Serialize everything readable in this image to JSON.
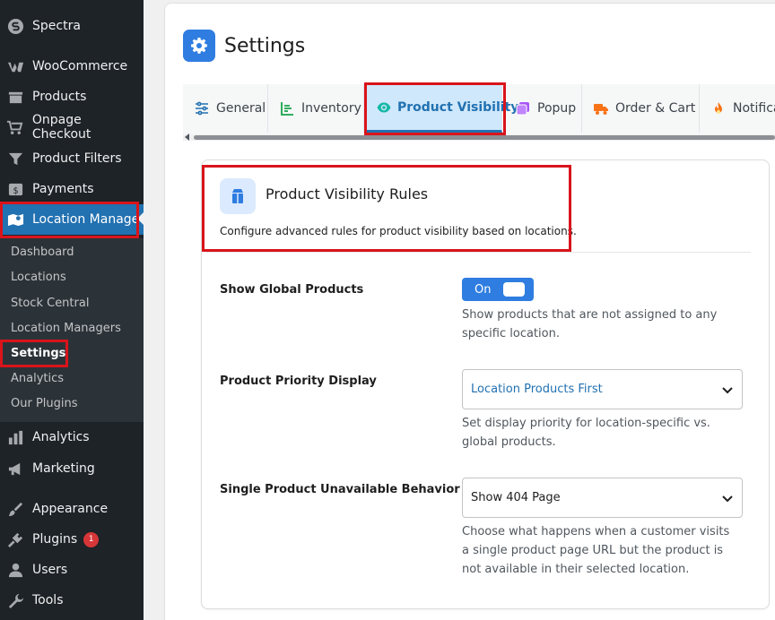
{
  "sidebar": {
    "items": [
      {
        "label": "Spectra",
        "icon": "spectra-icon"
      },
      {
        "label": "WooCommerce",
        "icon": "woocommerce-icon"
      },
      {
        "label": "Products",
        "icon": "products-icon"
      },
      {
        "label": "Onpage Checkout",
        "icon": "cart-icon"
      },
      {
        "label": "Product Filters",
        "icon": "filter-icon"
      },
      {
        "label": "Payments",
        "icon": "payments-icon"
      },
      {
        "label": "Location Manage",
        "icon": "map-icon"
      },
      {
        "label": "Analytics",
        "icon": "analytics-icon"
      },
      {
        "label": "Marketing",
        "icon": "megaphone-icon"
      },
      {
        "label": "Appearance",
        "icon": "paintbrush-icon"
      },
      {
        "label": "Plugins",
        "icon": "plugin-icon",
        "badge": "1"
      },
      {
        "label": "Users",
        "icon": "users-icon"
      },
      {
        "label": "Tools",
        "icon": "wrench-icon"
      }
    ],
    "submenu": [
      {
        "label": "Dashboard"
      },
      {
        "label": "Locations"
      },
      {
        "label": "Stock Central"
      },
      {
        "label": "Location Managers"
      },
      {
        "label": "Settings"
      },
      {
        "label": "Analytics"
      },
      {
        "label": "Our Plugins"
      }
    ]
  },
  "page": {
    "title": "Settings"
  },
  "tabs": [
    {
      "label": "General",
      "icon": "sliders-icon",
      "color": "#2271b1"
    },
    {
      "label": "Inventory",
      "icon": "bar-list-icon",
      "color": "#16a34a"
    },
    {
      "label": "Product Visibility",
      "icon": "eye-icon",
      "color": "#14b8a6"
    },
    {
      "label": "Popup",
      "icon": "popup-icon",
      "color": "#a855f7"
    },
    {
      "label": "Order & Cart",
      "icon": "truck-icon",
      "color": "#f97316"
    },
    {
      "label": "Notifica",
      "icon": "fire-icon",
      "color": "#f97316"
    }
  ],
  "section": {
    "title": "Product Visibility Rules",
    "subtitle": "Configure advanced rules for product visibility based on locations."
  },
  "fields": {
    "show_global": {
      "label": "Show Global Products",
      "toggle_text": "On",
      "help": "Show products that are not assigned to any specific location."
    },
    "priority": {
      "label": "Product Priority Display",
      "value": "Location Products First",
      "help": "Set display priority for location-specific vs. global products."
    },
    "unavailable": {
      "label": "Single Product Unavailable Behavior",
      "value": "Show 404 Page",
      "help": "Choose what happens when a customer visits a single product page URL but the product is not available in their selected location."
    }
  },
  "colors": {
    "accent": "#2f7de1",
    "highlight": "#d9141b",
    "sidebar_bg": "#1d2327",
    "active_tab_bg": "#cfe8fb"
  }
}
